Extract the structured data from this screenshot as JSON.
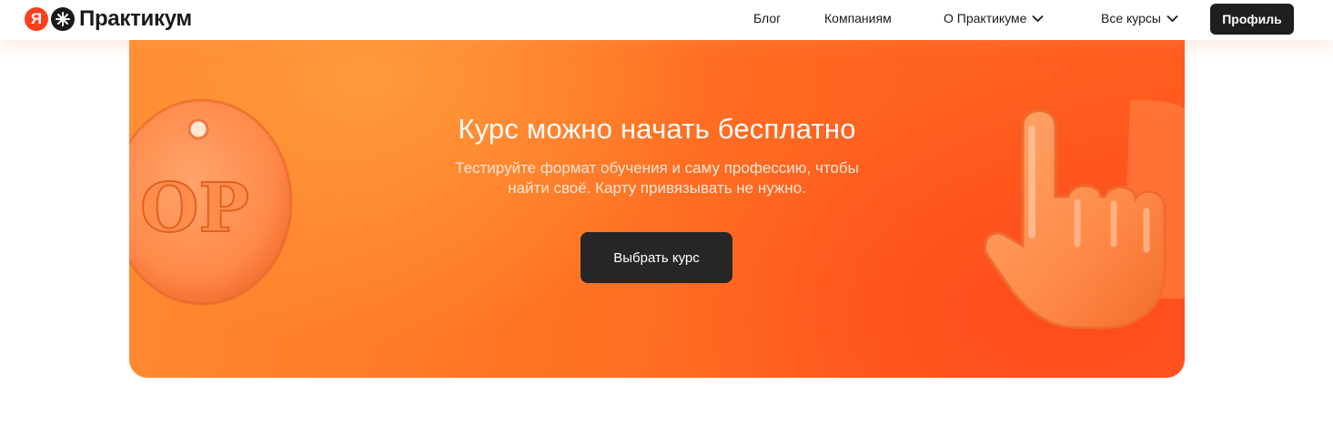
{
  "header": {
    "logo_mark": "Я",
    "logo_text": "Практикум",
    "nav": [
      {
        "label": "Блог",
        "has_dropdown": false
      },
      {
        "label": "Компаниям",
        "has_dropdown": false
      },
      {
        "label": "О Практикуме",
        "has_dropdown": true
      },
      {
        "label": "Все курсы",
        "has_dropdown": true
      }
    ],
    "profile_label": "Профиль"
  },
  "banner": {
    "headline": "Курс можно начать бесплатно",
    "subtitle_line1": "Тестируйте формат обучения и саму профессию, чтобы",
    "subtitle_line2": "найти своё. Карту привязывать не нужно.",
    "cta_label": "Выбрать курс",
    "coin_text": "OP",
    "decor_left": "coin-tag-icon",
    "decor_right": "pointing-hand-icon"
  },
  "colors": {
    "brand_red": "#fc3f1d",
    "banner_orange": "#ff7424",
    "dark_button": "#262626"
  }
}
